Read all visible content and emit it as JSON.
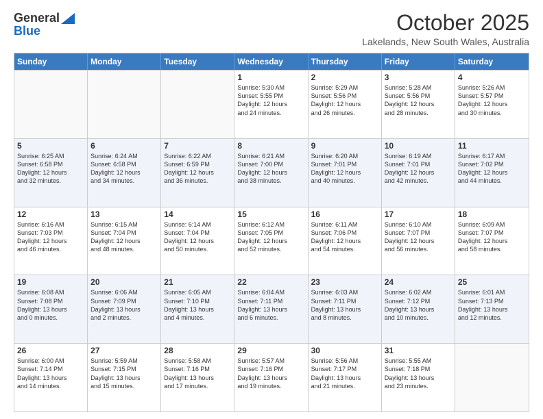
{
  "logo": {
    "general": "General",
    "blue": "Blue"
  },
  "header": {
    "month": "October 2025",
    "location": "Lakelands, New South Wales, Australia"
  },
  "days_of_week": [
    "Sunday",
    "Monday",
    "Tuesday",
    "Wednesday",
    "Thursday",
    "Friday",
    "Saturday"
  ],
  "weeks": [
    [
      {
        "day": "",
        "text": ""
      },
      {
        "day": "",
        "text": ""
      },
      {
        "day": "",
        "text": ""
      },
      {
        "day": "1",
        "text": "Sunrise: 5:30 AM\nSunset: 5:55 PM\nDaylight: 12 hours\nand 24 minutes."
      },
      {
        "day": "2",
        "text": "Sunrise: 5:29 AM\nSunset: 5:56 PM\nDaylight: 12 hours\nand 26 minutes."
      },
      {
        "day": "3",
        "text": "Sunrise: 5:28 AM\nSunset: 5:56 PM\nDaylight: 12 hours\nand 28 minutes."
      },
      {
        "day": "4",
        "text": "Sunrise: 5:26 AM\nSunset: 5:57 PM\nDaylight: 12 hours\nand 30 minutes."
      }
    ],
    [
      {
        "day": "5",
        "text": "Sunrise: 6:25 AM\nSunset: 6:58 PM\nDaylight: 12 hours\nand 32 minutes."
      },
      {
        "day": "6",
        "text": "Sunrise: 6:24 AM\nSunset: 6:58 PM\nDaylight: 12 hours\nand 34 minutes."
      },
      {
        "day": "7",
        "text": "Sunrise: 6:22 AM\nSunset: 6:59 PM\nDaylight: 12 hours\nand 36 minutes."
      },
      {
        "day": "8",
        "text": "Sunrise: 6:21 AM\nSunset: 7:00 PM\nDaylight: 12 hours\nand 38 minutes."
      },
      {
        "day": "9",
        "text": "Sunrise: 6:20 AM\nSunset: 7:01 PM\nDaylight: 12 hours\nand 40 minutes."
      },
      {
        "day": "10",
        "text": "Sunrise: 6:19 AM\nSunset: 7:01 PM\nDaylight: 12 hours\nand 42 minutes."
      },
      {
        "day": "11",
        "text": "Sunrise: 6:17 AM\nSunset: 7:02 PM\nDaylight: 12 hours\nand 44 minutes."
      }
    ],
    [
      {
        "day": "12",
        "text": "Sunrise: 6:16 AM\nSunset: 7:03 PM\nDaylight: 12 hours\nand 46 minutes."
      },
      {
        "day": "13",
        "text": "Sunrise: 6:15 AM\nSunset: 7:04 PM\nDaylight: 12 hours\nand 48 minutes."
      },
      {
        "day": "14",
        "text": "Sunrise: 6:14 AM\nSunset: 7:04 PM\nDaylight: 12 hours\nand 50 minutes."
      },
      {
        "day": "15",
        "text": "Sunrise: 6:12 AM\nSunset: 7:05 PM\nDaylight: 12 hours\nand 52 minutes."
      },
      {
        "day": "16",
        "text": "Sunrise: 6:11 AM\nSunset: 7:06 PM\nDaylight: 12 hours\nand 54 minutes."
      },
      {
        "day": "17",
        "text": "Sunrise: 6:10 AM\nSunset: 7:07 PM\nDaylight: 12 hours\nand 56 minutes."
      },
      {
        "day": "18",
        "text": "Sunrise: 6:09 AM\nSunset: 7:07 PM\nDaylight: 12 hours\nand 58 minutes."
      }
    ],
    [
      {
        "day": "19",
        "text": "Sunrise: 6:08 AM\nSunset: 7:08 PM\nDaylight: 13 hours\nand 0 minutes."
      },
      {
        "day": "20",
        "text": "Sunrise: 6:06 AM\nSunset: 7:09 PM\nDaylight: 13 hours\nand 2 minutes."
      },
      {
        "day": "21",
        "text": "Sunrise: 6:05 AM\nSunset: 7:10 PM\nDaylight: 13 hours\nand 4 minutes."
      },
      {
        "day": "22",
        "text": "Sunrise: 6:04 AM\nSunset: 7:11 PM\nDaylight: 13 hours\nand 6 minutes."
      },
      {
        "day": "23",
        "text": "Sunrise: 6:03 AM\nSunset: 7:11 PM\nDaylight: 13 hours\nand 8 minutes."
      },
      {
        "day": "24",
        "text": "Sunrise: 6:02 AM\nSunset: 7:12 PM\nDaylight: 13 hours\nand 10 minutes."
      },
      {
        "day": "25",
        "text": "Sunrise: 6:01 AM\nSunset: 7:13 PM\nDaylight: 13 hours\nand 12 minutes."
      }
    ],
    [
      {
        "day": "26",
        "text": "Sunrise: 6:00 AM\nSunset: 7:14 PM\nDaylight: 13 hours\nand 14 minutes."
      },
      {
        "day": "27",
        "text": "Sunrise: 5:59 AM\nSunset: 7:15 PM\nDaylight: 13 hours\nand 15 minutes."
      },
      {
        "day": "28",
        "text": "Sunrise: 5:58 AM\nSunset: 7:16 PM\nDaylight: 13 hours\nand 17 minutes."
      },
      {
        "day": "29",
        "text": "Sunrise: 5:57 AM\nSunset: 7:16 PM\nDaylight: 13 hours\nand 19 minutes."
      },
      {
        "day": "30",
        "text": "Sunrise: 5:56 AM\nSunset: 7:17 PM\nDaylight: 13 hours\nand 21 minutes."
      },
      {
        "day": "31",
        "text": "Sunrise: 5:55 AM\nSunset: 7:18 PM\nDaylight: 13 hours\nand 23 minutes."
      },
      {
        "day": "",
        "text": ""
      }
    ]
  ]
}
